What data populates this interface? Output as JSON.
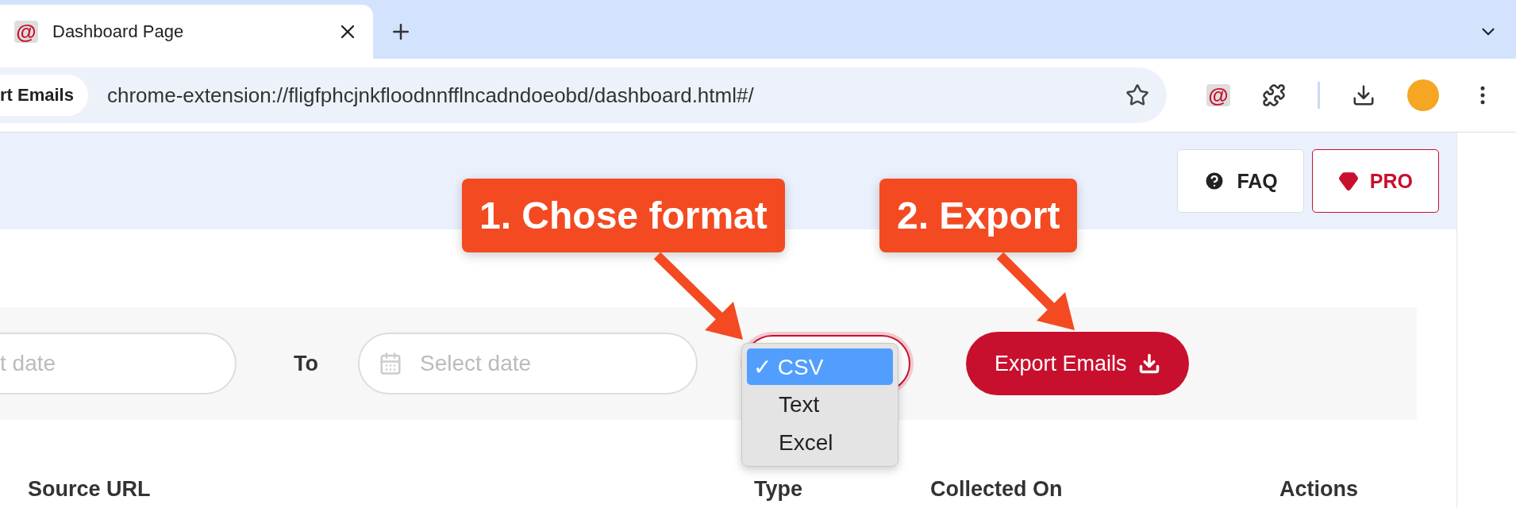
{
  "browser": {
    "tabs": [
      {
        "favicon": "@",
        "title": "Dashboard Page",
        "selected": true
      }
    ],
    "extension_icon": "@",
    "address_bar": {
      "chip": "rt Emails",
      "url": "chrome-extension://fligfphcjnkfloodnnfflncadndoeobd/dashboard.html#/"
    }
  },
  "header": {
    "buttons": [
      {
        "label": "FAQ",
        "kind": "faq"
      },
      {
        "label": "PRO",
        "kind": "pro"
      }
    ]
  },
  "filters": {
    "from_placeholder": "t date",
    "to_label": "To",
    "to_placeholder": "Select date",
    "check": "✓",
    "format_menu": [
      {
        "label": "CSV",
        "selected": true
      },
      {
        "label": "Text",
        "selected": false
      },
      {
        "label": "Excel",
        "selected": false
      }
    ],
    "export_button": "Export Emails"
  },
  "table": {
    "columns": [
      "Source URL",
      "Type",
      "Collected On",
      "Actions"
    ]
  },
  "annotations": [
    {
      "text": "1. Chose format"
    },
    {
      "text": "2. Export"
    }
  ]
}
